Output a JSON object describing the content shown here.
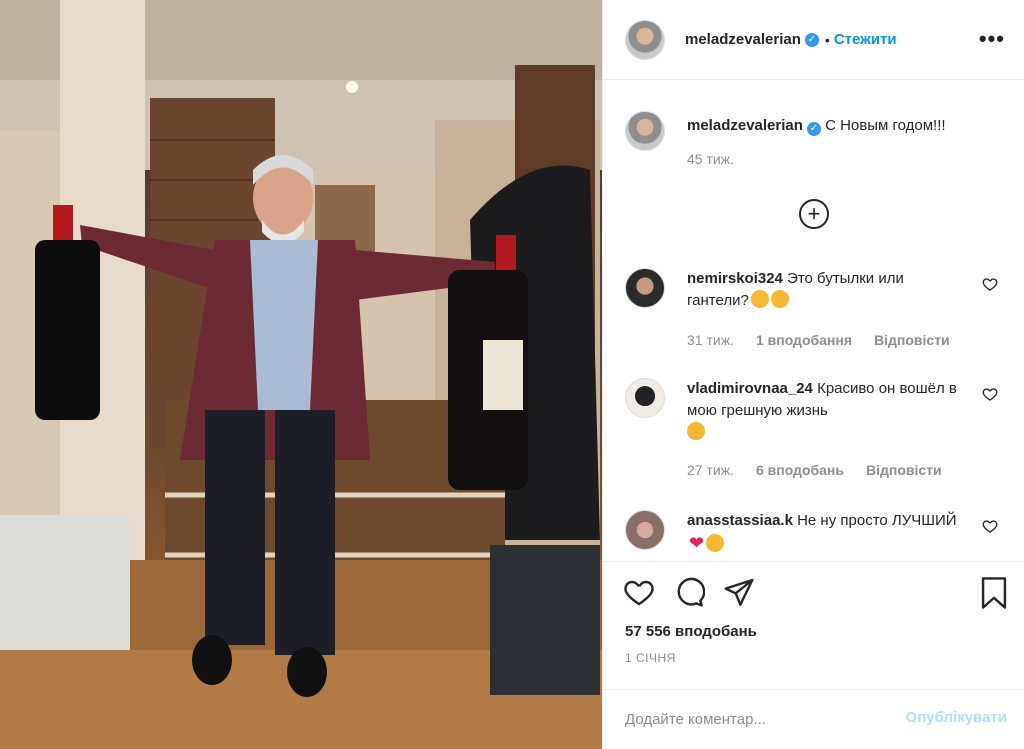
{
  "header": {
    "username": "meladzevalerian",
    "verified_mark": "✓",
    "separator": "•",
    "follow_label": "Стежити",
    "more_label": "•••"
  },
  "caption": {
    "username": "meladzevalerian",
    "text": "С Новым годом!!!",
    "time": "45 тиж."
  },
  "load_more_label": "+",
  "comments": [
    {
      "username": "nemirskoi324",
      "text": "Это бутылки или гантели?",
      "time": "31 тиж.",
      "likes": "1 вподобання",
      "reply_label": "Відповісти"
    },
    {
      "username": "vladimirovnaa_24",
      "text": "Красиво он вошёл в мою грешную жизнь",
      "time": "27 тиж.",
      "likes": "6 вподобань",
      "reply_label": "Відповісти"
    },
    {
      "username": "anasstassiaa.k",
      "text": "Не ну просто ЛУЧШИЙ",
      "heart": "❤"
    }
  ],
  "post": {
    "likes_label": "57 556 вподобань",
    "date": "1 СІЧНЯ"
  },
  "comment_input": {
    "placeholder": "Додайте коментар...",
    "publish_label": "Опублікувати"
  },
  "colors": {
    "accent": "#0095f6",
    "muted": "#8e8e8e",
    "verified": "#3897f0",
    "publish_disabled": "#b2dffc"
  }
}
